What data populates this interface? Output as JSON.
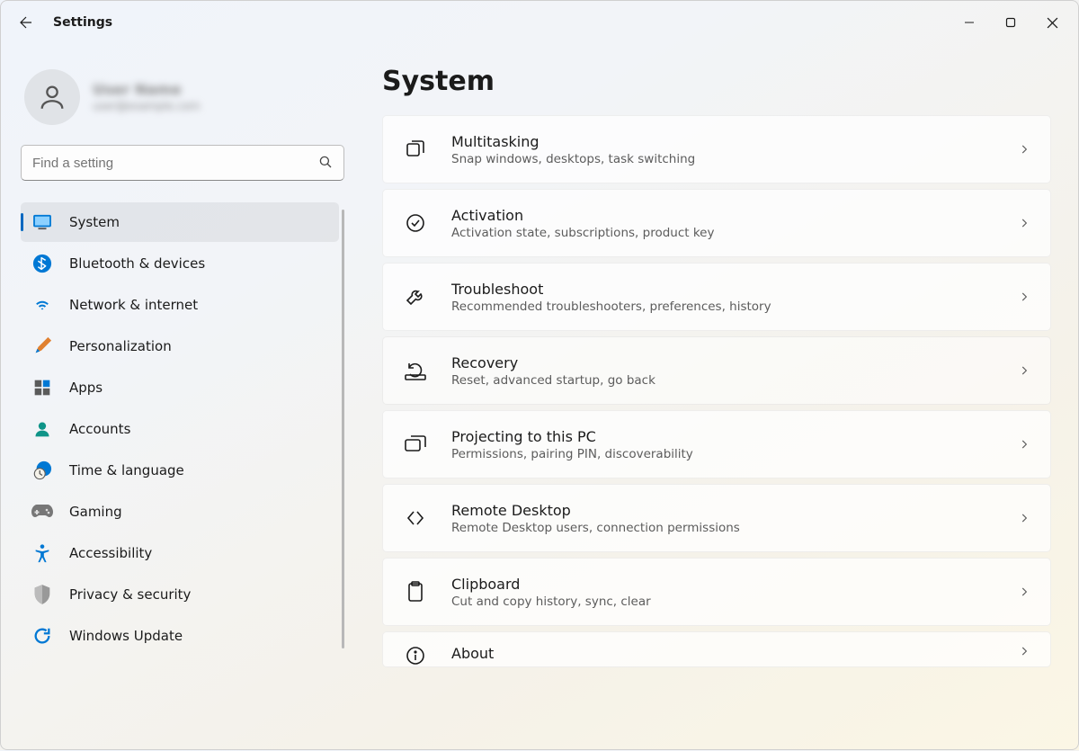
{
  "window": {
    "title": "Settings"
  },
  "profile": {
    "name": "User Name",
    "email": "user@example.com"
  },
  "search": {
    "placeholder": "Find a setting"
  },
  "sidebar": {
    "items": [
      {
        "label": "System"
      },
      {
        "label": "Bluetooth & devices"
      },
      {
        "label": "Network & internet"
      },
      {
        "label": "Personalization"
      },
      {
        "label": "Apps"
      },
      {
        "label": "Accounts"
      },
      {
        "label": "Time & language"
      },
      {
        "label": "Gaming"
      },
      {
        "label": "Accessibility"
      },
      {
        "label": "Privacy & security"
      },
      {
        "label": "Windows Update"
      }
    ]
  },
  "page": {
    "title": "System"
  },
  "cards": [
    {
      "title": "Multitasking",
      "desc": "Snap windows, desktops, task switching"
    },
    {
      "title": "Activation",
      "desc": "Activation state, subscriptions, product key"
    },
    {
      "title": "Troubleshoot",
      "desc": "Recommended troubleshooters, preferences, history"
    },
    {
      "title": "Recovery",
      "desc": "Reset, advanced startup, go back"
    },
    {
      "title": "Projecting to this PC",
      "desc": "Permissions, pairing PIN, discoverability"
    },
    {
      "title": "Remote Desktop",
      "desc": "Remote Desktop users, connection permissions"
    },
    {
      "title": "Clipboard",
      "desc": "Cut and copy history, sync, clear"
    },
    {
      "title": "About",
      "desc": ""
    }
  ]
}
